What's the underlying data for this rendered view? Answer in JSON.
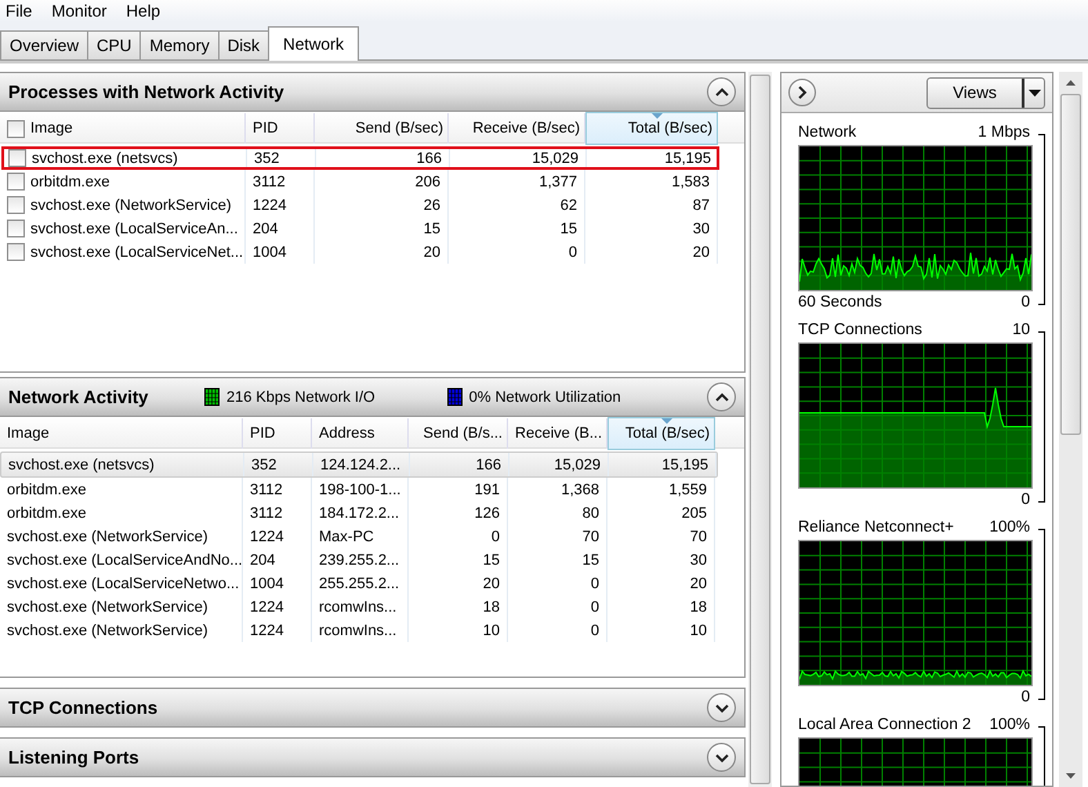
{
  "menu": [
    "File",
    "Monitor",
    "Help"
  ],
  "tabs": [
    {
      "label": "Overview",
      "selected": false
    },
    {
      "label": "CPU",
      "selected": false
    },
    {
      "label": "Memory",
      "selected": false
    },
    {
      "label": "Disk",
      "selected": false
    },
    {
      "label": "Network",
      "selected": true
    }
  ],
  "processes": {
    "title": "Processes with Network Activity",
    "expanded": true,
    "all_checked": false,
    "columns": [
      {
        "label": "Image",
        "sorted": false
      },
      {
        "label": "PID",
        "sorted": false
      },
      {
        "label": "Send (B/sec)",
        "sorted": false
      },
      {
        "label": "Receive (B/sec)",
        "sorted": false
      },
      {
        "label": "Total (B/sec)",
        "sorted": true
      }
    ],
    "rows": [
      {
        "checked": false,
        "highlighted": true,
        "cells": [
          "svchost.exe (netsvcs)",
          "352",
          "166",
          "15,029",
          "15,195"
        ]
      },
      {
        "checked": false,
        "highlighted": false,
        "cells": [
          "orbitdm.exe",
          "3112",
          "206",
          "1,377",
          "1,583"
        ]
      },
      {
        "checked": false,
        "highlighted": false,
        "cells": [
          "svchost.exe (NetworkService)",
          "1224",
          "26",
          "62",
          "87"
        ]
      },
      {
        "checked": false,
        "highlighted": false,
        "cells": [
          "svchost.exe (LocalServiceAn...",
          "204",
          "15",
          "15",
          "30"
        ]
      },
      {
        "checked": false,
        "highlighted": false,
        "cells": [
          "svchost.exe (LocalServiceNet...",
          "1004",
          "20",
          "0",
          "20"
        ]
      }
    ]
  },
  "network_activity": {
    "title": "Network Activity",
    "expanded": true,
    "legend": [
      {
        "text": "216 Kbps Network I/O",
        "color": "#00c000"
      },
      {
        "text": "0% Network Utilization",
        "color": "#0000e0"
      }
    ],
    "columns": [
      {
        "label": "Image",
        "sorted": false
      },
      {
        "label": "PID",
        "sorted": false
      },
      {
        "label": "Address",
        "sorted": false
      },
      {
        "label": "Send (B/s...",
        "sorted": false
      },
      {
        "label": "Receive (B...",
        "sorted": false
      },
      {
        "label": "Total (B/sec)",
        "sorted": true
      }
    ],
    "rows": [
      {
        "selected": true,
        "cells": [
          "svchost.exe (netsvcs)",
          "352",
          "124.124.2...",
          "166",
          "15,029",
          "15,195"
        ]
      },
      {
        "selected": false,
        "cells": [
          "orbitdm.exe",
          "3112",
          "198-100-1...",
          "191",
          "1,368",
          "1,559"
        ]
      },
      {
        "selected": false,
        "cells": [
          "orbitdm.exe",
          "3112",
          "184.172.2...",
          "126",
          "80",
          "205"
        ]
      },
      {
        "selected": false,
        "cells": [
          "svchost.exe (NetworkService)",
          "1224",
          "Max-PC",
          "0",
          "70",
          "70"
        ]
      },
      {
        "selected": false,
        "cells": [
          "svchost.exe (LocalServiceAndNo...",
          "204",
          "239.255.2...",
          "15",
          "15",
          "30"
        ]
      },
      {
        "selected": false,
        "cells": [
          "svchost.exe (LocalServiceNetwo...",
          "1004",
          "255.255.2...",
          "20",
          "0",
          "20"
        ]
      },
      {
        "selected": false,
        "cells": [
          "svchost.exe (NetworkService)",
          "1224",
          "rcomwIns...",
          "18",
          "0",
          "18"
        ]
      },
      {
        "selected": false,
        "cells": [
          "svchost.exe (NetworkService)",
          "1224",
          "rcomwIns...",
          "10",
          "0",
          "10"
        ]
      }
    ]
  },
  "collapsed_sections": [
    {
      "title": "TCP Connections",
      "expanded": false
    },
    {
      "title": "Listening Ports",
      "expanded": false
    }
  ],
  "side": {
    "views_label": "Views",
    "graphs": [
      {
        "title": "Network",
        "scale_max": "1 Mbps",
        "kind": "spikes",
        "footer_left": "60 Seconds",
        "scale_min": "0"
      },
      {
        "title": "TCP Connections",
        "scale_max": "10",
        "kind": "step",
        "scale_min": "0"
      },
      {
        "title": "Reliance Netconnect+",
        "scale_max": "100%",
        "kind": "wave",
        "scale_min": "0"
      },
      {
        "title": "Local Area Connection 2",
        "scale_max": "100%",
        "kind": "empty"
      }
    ]
  }
}
